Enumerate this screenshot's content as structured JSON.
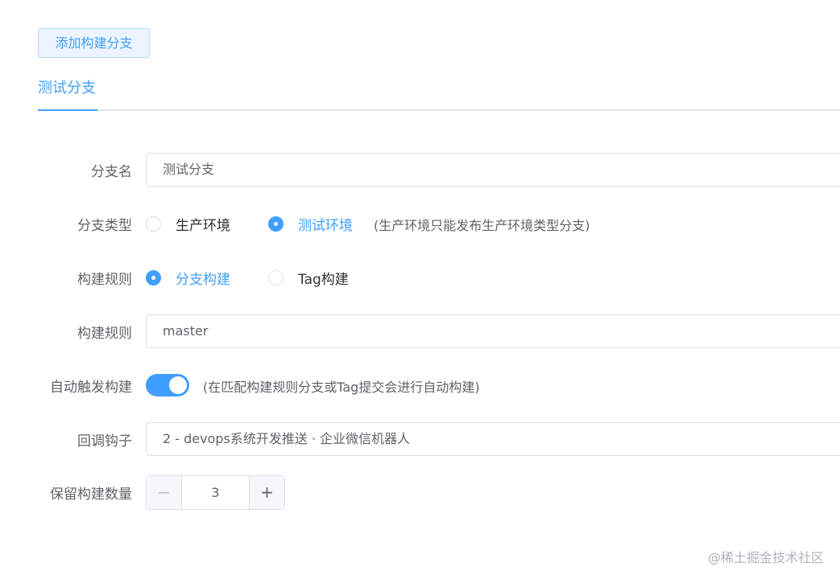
{
  "toolbar": {
    "add_branch_label": "添加构建分支"
  },
  "tabs": [
    {
      "label": "测试分支",
      "active": true
    }
  ],
  "form": {
    "branch_name": {
      "label": "分支名",
      "value": "测试分支"
    },
    "branch_type": {
      "label": "分支类型",
      "options": [
        {
          "label": "生产环境",
          "checked": false
        },
        {
          "label": "测试环境",
          "checked": true
        }
      ],
      "hint": "(生产环境只能发布生产环境类型分支)"
    },
    "build_rule_type": {
      "label": "构建规则",
      "options": [
        {
          "label": "分支构建",
          "checked": true
        },
        {
          "label": "Tag构建",
          "checked": false
        }
      ]
    },
    "build_rule": {
      "label": "构建规则",
      "value": "master"
    },
    "auto_trigger": {
      "label": "自动触发构建",
      "enabled": true,
      "hint": "(在匹配构建规则分支或Tag提交会进行自动构建)"
    },
    "callback_hook": {
      "label": "回调钩子",
      "value": "2 - devops系统开发推送 · 企业微信机器人"
    },
    "keep_count": {
      "label": "保留构建数量",
      "value": "3",
      "minus": "−",
      "plus": "+"
    }
  },
  "watermark": "@稀土掘金技术社区",
  "colors": {
    "primary": "#409eff",
    "border": "#dcdfe6",
    "text": "#606266"
  }
}
